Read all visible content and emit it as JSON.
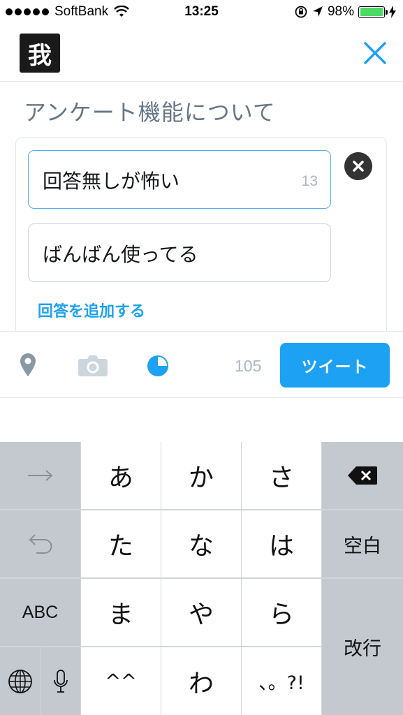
{
  "status_bar": {
    "carrier": "SoftBank",
    "time": "13:25",
    "battery": "98%",
    "battery_level": 0.98
  },
  "header": {
    "avatar_char": "我"
  },
  "compose": {
    "text": "アンケート機能について"
  },
  "poll": {
    "choices": [
      {
        "text": "回答無しが怖い",
        "count": "13"
      },
      {
        "text": "ばんばん使ってる"
      }
    ],
    "add_choice_label": "回答を追加する"
  },
  "toolbar": {
    "char_count": "105",
    "tweet_label": "ツイート"
  },
  "keyboard": {
    "row1": [
      "あ",
      "か",
      "さ"
    ],
    "row2": [
      "た",
      "な",
      "は"
    ],
    "row3": [
      "ま",
      "や",
      "ら"
    ],
    "row4": [
      "^^",
      "わ",
      "、。?!"
    ],
    "abc_label": "ABC",
    "space_label": "空白",
    "return_label": "改行"
  },
  "colors": {
    "accent": "#1da1f2",
    "border": "#e1e8ed",
    "muted": "#aab8c2"
  }
}
